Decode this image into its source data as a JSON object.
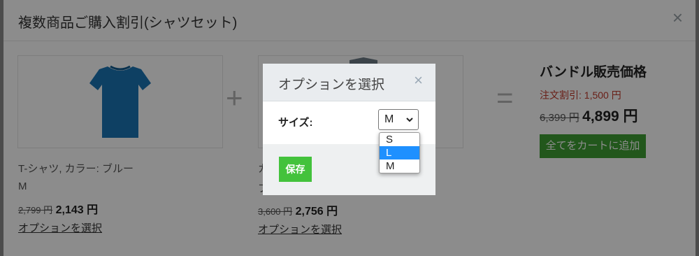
{
  "modal": {
    "title": "複数商品ご購入割引(シャツセット)",
    "close": "×"
  },
  "products": [
    {
      "name": "T-シャツ, カラー: ブルー",
      "variant": "M",
      "old_price": "2,799 円",
      "new_price": "2,143 円",
      "options_link": "オプションを選択"
    },
    {
      "name": "カ",
      "variant": "ブ",
      "old_price": "3,600 円",
      "new_price": "2,756 円",
      "options_link": "オプションを選択"
    }
  ],
  "operators": {
    "plus": "+",
    "equals": "="
  },
  "bundle": {
    "title": "バンドル販売価格",
    "discount": "注文割引: 1,500 円",
    "old_price": "6,399 円",
    "new_price": "4,899 円",
    "add_button": "全てをカートに追加",
    "button_color": "#3f9f34"
  },
  "dialog": {
    "title": "オプションを選択",
    "close": "×",
    "size_label": "サイズ:",
    "selected": "M",
    "options": [
      "S",
      "L",
      "M"
    ],
    "highlighted": "L",
    "save": "保存",
    "save_color": "#43c23c"
  }
}
